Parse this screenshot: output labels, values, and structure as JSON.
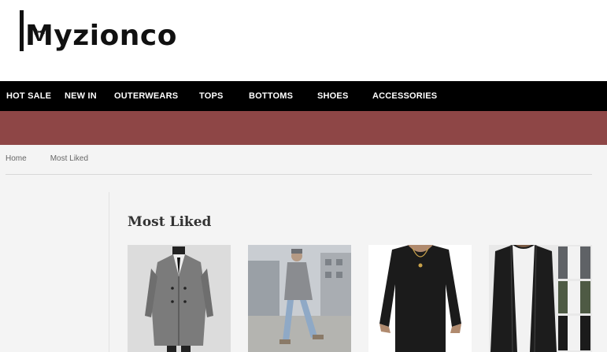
{
  "brand": {
    "name": "Myzionco",
    "mark_letter": "M"
  },
  "nav": {
    "items": [
      {
        "label": "HOT SALE"
      },
      {
        "label": "NEW IN"
      },
      {
        "label": "OUTERWEARS"
      },
      {
        "label": "TOPS"
      },
      {
        "label": "BOTTOMS"
      },
      {
        "label": "SHOES"
      },
      {
        "label": "ACCESSORIES"
      }
    ]
  },
  "breadcrumb": {
    "home": "Home",
    "current": "Most Liked"
  },
  "section": {
    "title": "Most Liked"
  },
  "products": [
    {
      "image": "grey-double-breasted-trench-coat"
    },
    {
      "image": "man-walking-in-grey-coat-street"
    },
    {
      "image": "black-long-sleeve-shirt"
    },
    {
      "image": "black-zip-jacket-color-variants"
    }
  ],
  "colors": {
    "nav_bg": "#000000",
    "promo_bar": "#8e4646",
    "content_bg": "#f4f4f4"
  }
}
